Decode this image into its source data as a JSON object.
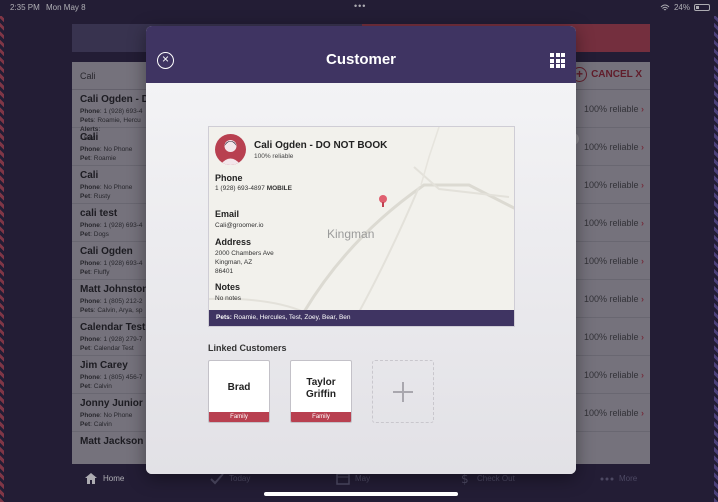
{
  "status_bar": {
    "time": "2:35 PM",
    "date": "Mon May 8",
    "battery": "24%"
  },
  "background": {
    "search_query": "Cali",
    "cancel_label": "CANCEL X",
    "rows": [
      {
        "name": "Cali Ogden - D",
        "lines": [
          [
            "Phone",
            "1 (928) 693-4"
          ],
          [
            "Pets",
            "Roamie, Hercu"
          ],
          [
            "Alerts",
            ""
          ],
          [
            "",
            "- Bad"
          ]
        ],
        "reliability": "100% reliable"
      },
      {
        "name": "Cali",
        "lines": [
          [
            "Phone",
            "No Phone"
          ],
          [
            "Pet",
            "Roamie"
          ]
        ],
        "reliability": "100% reliable"
      },
      {
        "name": "Cali",
        "lines": [
          [
            "Phone",
            "No Phone"
          ],
          [
            "Pet",
            "Rusty"
          ]
        ],
        "reliability": "100% reliable"
      },
      {
        "name": "cali test",
        "lines": [
          [
            "Phone",
            "1 (928) 693-4"
          ],
          [
            "Pet",
            "Dogs"
          ]
        ],
        "reliability": "100% reliable"
      },
      {
        "name": "Cali Ogden",
        "lines": [
          [
            "Phone",
            "1 (928) 693-4"
          ],
          [
            "Pet",
            "Fluffy"
          ]
        ],
        "reliability": "100% reliable"
      },
      {
        "name": "Matt Johnston",
        "lines": [
          [
            "Phone",
            "1 (805) 212-2"
          ],
          [
            "Pets",
            "Calvin, Arya, sp"
          ]
        ],
        "reliability": "100% reliable"
      },
      {
        "name": "Calendar Test",
        "lines": [
          [
            "Phone",
            "1 (928) 279-7"
          ],
          [
            "Pet",
            "Calendar Test"
          ]
        ],
        "reliability": "100% reliable"
      },
      {
        "name": "Jim Carey",
        "lines": [
          [
            "Phone",
            "1 (805) 456-7"
          ],
          [
            "Pet",
            "Calvin"
          ]
        ],
        "reliability": "100% reliable"
      },
      {
        "name": "Jonny Junior",
        "lines": [
          [
            "Phone",
            "No Phone"
          ],
          [
            "Pet",
            "Calvin"
          ]
        ],
        "reliability": "100% reliable"
      },
      {
        "name": "Matt Jackson",
        "lines": [],
        "reliability": ""
      }
    ],
    "tabs": [
      "Home",
      "Today",
      "May",
      "Check Out",
      "More"
    ]
  },
  "modal": {
    "title": "Customer",
    "customer": {
      "name": "Cali Ogden - DO NOT BOOK",
      "reliability": "100% reliable",
      "phone_label": "Phone",
      "phone": "1 (928) 693-4897",
      "phone_type": "MOBILE",
      "email_label": "Email",
      "email": "Cali@groomer.io",
      "address_label": "Address",
      "address_line1": "2000 Chambers Ave",
      "address_line2": "Kingman, AZ",
      "address_line3": "86401",
      "notes_label": "Notes",
      "notes": "No notes",
      "map_city": "Kingman",
      "pets_label": "Pets:",
      "pets": "Roamie, Hercules, Test, Zoey, Bear, Ben"
    },
    "linked_title": "Linked Customers",
    "linked": [
      {
        "name": "Brad",
        "tag": "Family"
      },
      {
        "name": "Taylor Griffin",
        "tag": "Family"
      }
    ]
  },
  "colors": {
    "header": "#3f3462",
    "accent": "#b84050"
  }
}
